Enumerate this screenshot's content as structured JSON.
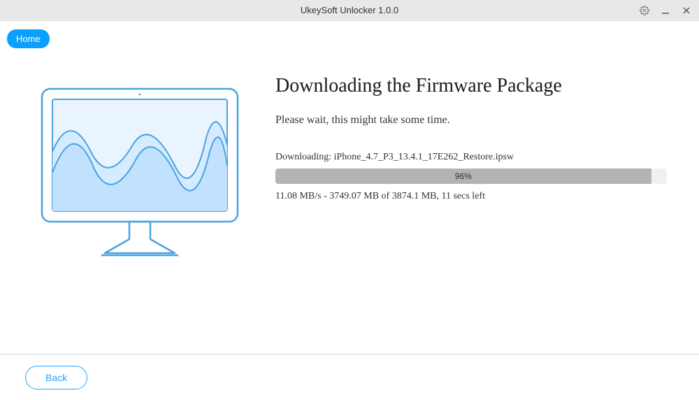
{
  "titlebar": {
    "title": "UkeySoft Unlocker 1.0.0"
  },
  "nav": {
    "home_label": "Home"
  },
  "main": {
    "heading": "Downloading the Firmware Package",
    "subtext": "Please wait, this might take some time.",
    "download_line": "Downloading: iPhone_4.7_P3_13.4.1_17E262_Restore.ipsw",
    "progress_percent_label": "96%",
    "progress_width_css": "width:96%",
    "status_line": "11.08 MB/s - 3749.07 MB of 3874.1 MB, 11 secs left"
  },
  "footer": {
    "back_label": "Back"
  }
}
